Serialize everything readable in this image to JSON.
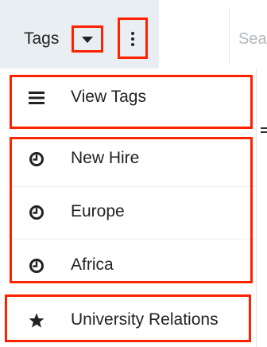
{
  "header": {
    "tab_label": "Tags",
    "search_placeholder_partial": "Sea"
  },
  "menu": {
    "view_item": {
      "label": "View Tags",
      "icon": "list-icon"
    },
    "recent_tags": [
      {
        "label": "New Hire",
        "icon": "clock-icon"
      },
      {
        "label": "Europe",
        "icon": "clock-icon"
      },
      {
        "label": "Africa",
        "icon": "clock-icon"
      }
    ],
    "favorite_tags": [
      {
        "label": "University Relations",
        "icon": "star-icon"
      }
    ]
  },
  "colors": {
    "highlight": "#ff2200",
    "tab_background": "#e9eef3",
    "text": "#222222"
  }
}
